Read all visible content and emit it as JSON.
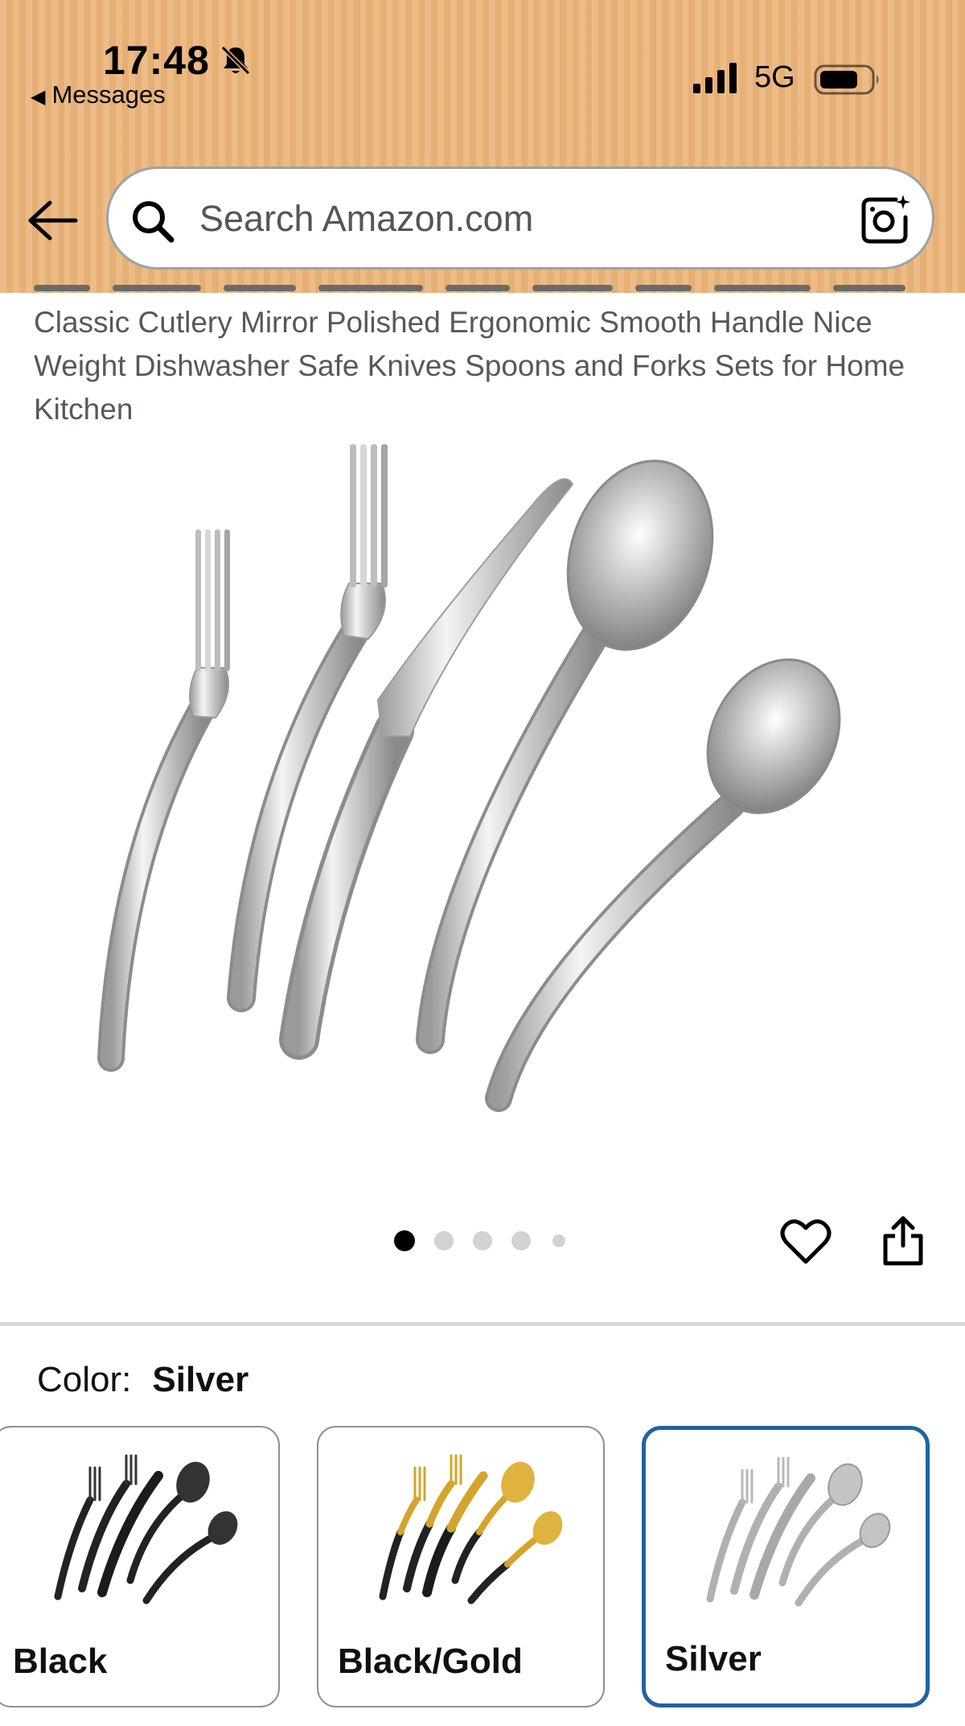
{
  "status_bar": {
    "time": "17:48",
    "back_app": "Messages",
    "network": "5G"
  },
  "header": {
    "background_color": "#ebb379",
    "search_placeholder": "Search Amazon.com"
  },
  "product": {
    "title": "Classic Cutlery Mirror Polished Ergonomic Smooth Handle Nice Weight Dishwasher Safe Knives Spoons and Forks Sets for Home Kitchen",
    "image_count": 5,
    "current_image": 1
  },
  "color": {
    "label": "Color:",
    "selected": "Silver",
    "options": [
      {
        "name": "Black",
        "selected": false
      },
      {
        "name": "Black/Gold",
        "selected": false
      },
      {
        "name": "Silver",
        "selected": true
      }
    ]
  },
  "colors": {
    "selected_border": "#2162a1",
    "text": "#0f1111",
    "title_text": "#565959"
  }
}
